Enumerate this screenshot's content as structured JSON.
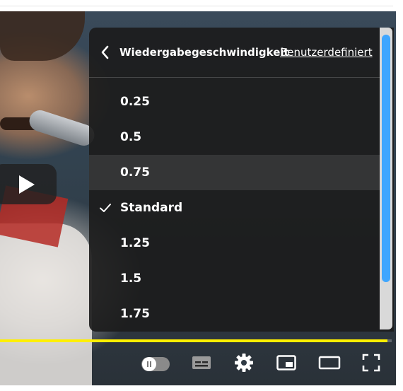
{
  "settings_panel": {
    "title": "Wiedergabegeschwindigkeit",
    "custom_link": "Benutzerdefiniert",
    "back_icon": "chevron-left-icon",
    "options": [
      {
        "label": "0.25",
        "selected": false,
        "highlighted": false
      },
      {
        "label": "0.5",
        "selected": false,
        "highlighted": false
      },
      {
        "label": "0.75",
        "selected": false,
        "highlighted": true
      },
      {
        "label": "Standard",
        "selected": true,
        "highlighted": false
      },
      {
        "label": "1.25",
        "selected": false,
        "highlighted": false
      },
      {
        "label": "1.5",
        "selected": false,
        "highlighted": false
      },
      {
        "label": "1.75",
        "selected": false,
        "highlighted": false
      }
    ]
  },
  "player": {
    "progress_fraction": 0.99,
    "colors": {
      "progress": "#ffef00",
      "scroll_thumb": "#3ea6ff",
      "panel_bg": "#1c1c1c"
    },
    "controls": [
      "autoplay-toggle",
      "subtitles-icon",
      "gear-icon",
      "miniplayer-icon",
      "theater-mode-icon",
      "fullscreen-icon"
    ]
  }
}
